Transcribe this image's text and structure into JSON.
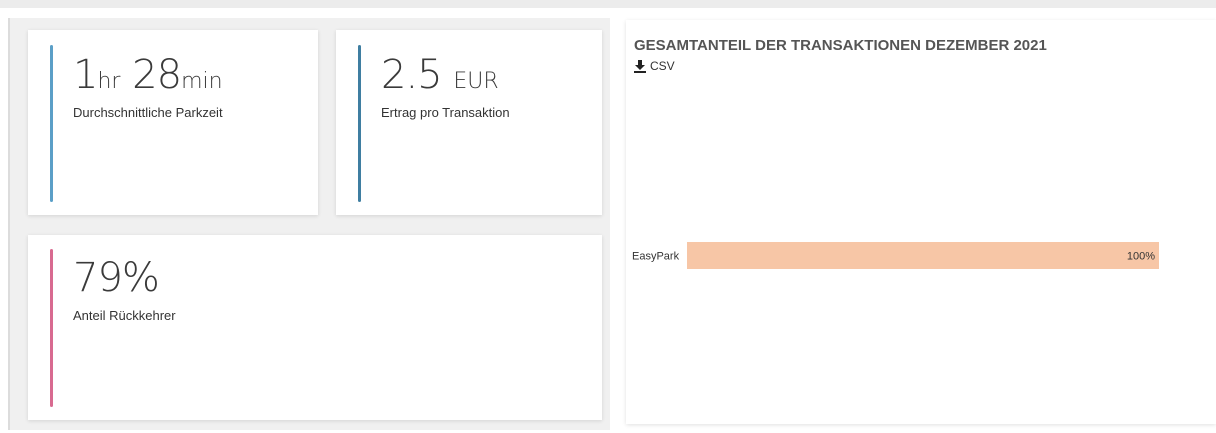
{
  "kpis": {
    "parkzeit": {
      "hours": "1",
      "hours_unit": "hr",
      "minutes": "28",
      "minutes_unit": "min",
      "label": "Durchschnittliche Parkzeit",
      "color": "#5b9fc7"
    },
    "ertrag": {
      "value": "2.5",
      "unit": "EUR",
      "label": "Ertrag pro Transaktion",
      "color": "#3f7ea1"
    },
    "rueckkehrer": {
      "value": "79%",
      "label": "Anteil Rückkehrer",
      "color": "#d86a90"
    }
  },
  "chart_panel": {
    "title": "GESAMTANTEIL DER TRANSAKTIONEN DEZEMBER 2021",
    "download_label": "CSV",
    "download_icon": "download-icon"
  },
  "chart_data": {
    "type": "bar",
    "orientation": "horizontal",
    "title": "GESAMTANTEIL DER TRANSAKTIONEN DEZEMBER 2021",
    "categories": [
      "EasyPark"
    ],
    "values": [
      100
    ],
    "value_labels": [
      "100%"
    ],
    "xlim": [
      0,
      100
    ],
    "bar_color": "#f7c6a6",
    "grid": false
  }
}
